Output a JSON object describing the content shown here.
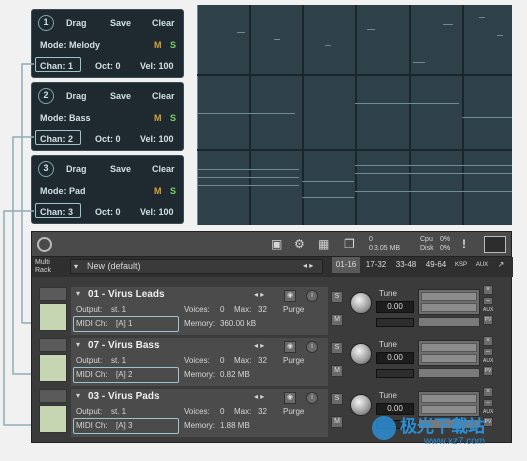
{
  "tracks": [
    {
      "num": "1",
      "drag": "Drag",
      "save": "Save",
      "clear": "Clear",
      "mode": "Mode: Melody",
      "m": "M",
      "s": "S",
      "chan": "Chan: 1",
      "oct": "Oct: 0",
      "vel": "Vel: 100"
    },
    {
      "num": "2",
      "drag": "Drag",
      "save": "Save",
      "clear": "Clear",
      "mode": "Mode: Bass",
      "m": "M",
      "s": "S",
      "chan": "Chan: 2",
      "oct": "Oct: 0",
      "vel": "Vel: 100"
    },
    {
      "num": "3",
      "drag": "Drag",
      "save": "Save",
      "clear": "Clear",
      "mode": "Mode: Pad",
      "m": "M",
      "s": "S",
      "chan": "Chan: 3",
      "oct": "Oct: 0",
      "vel": "Vel: 100"
    }
  ],
  "toolbar": {
    "midi_count": "0",
    "memory": "3.05 MB",
    "audio_count": "0",
    "cpu_label": "Cpu",
    "cpu_value": "0%",
    "disk_label": "Disk",
    "disk_value": "0%",
    "warn": "!"
  },
  "rack": {
    "label_line1": "Multi",
    "label_line2": "Rack",
    "preset": "New (default)",
    "tabs": [
      "01-16",
      "17-32",
      "33-48",
      "49-64"
    ],
    "ksp": "KSP",
    "aux": "AUX"
  },
  "instruments": [
    {
      "name": "01 - Virus Leads",
      "output_label": "Output:",
      "output": "st. 1",
      "voices_label": "Voices:",
      "voices": "0",
      "max_label": "Max:",
      "max": "32",
      "purge": "Purge",
      "midi_label": "MIDI Ch:",
      "midi": "[A]  1",
      "memory_label": "Memory:",
      "memory": "360.00 kB",
      "tune_label": "Tune",
      "tune": "0.00",
      "s": "S",
      "m": "M",
      "aux": "AUX",
      "pv": "PV"
    },
    {
      "name": "07 - Virus Bass",
      "output_label": "Output:",
      "output": "st. 1",
      "voices_label": "Voices:",
      "voices": "0",
      "max_label": "Max:",
      "max": "32",
      "purge": "Purge",
      "midi_label": "MIDI Ch:",
      "midi": "[A]  2",
      "memory_label": "Memory:",
      "memory": "0.82 MB",
      "tune_label": "Tune",
      "tune": "0.00",
      "s": "S",
      "m": "M",
      "aux": "AUX",
      "pv": "PV"
    },
    {
      "name": "03 - Virus Pads",
      "output_label": "Output:",
      "output": "st. 1",
      "voices_label": "Voices:",
      "voices": "0",
      "max_label": "Max:",
      "max": "32",
      "purge": "Purge",
      "midi_label": "MIDI Ch:",
      "midi": "[A]  3",
      "memory_label": "Memory:",
      "memory": "1.88 MB",
      "tune_label": "Tune",
      "tune": "0.00",
      "s": "S",
      "m": "M",
      "aux": "AUX",
      "pv": "PV"
    }
  ],
  "watermark": {
    "text": "极光下载站",
    "url": "www.xz7.com"
  },
  "colors": {
    "panel": "#1f2a30",
    "grid": "#2e4149",
    "rack": "#3b3b3b",
    "highlight": "#9fc2cf"
  }
}
